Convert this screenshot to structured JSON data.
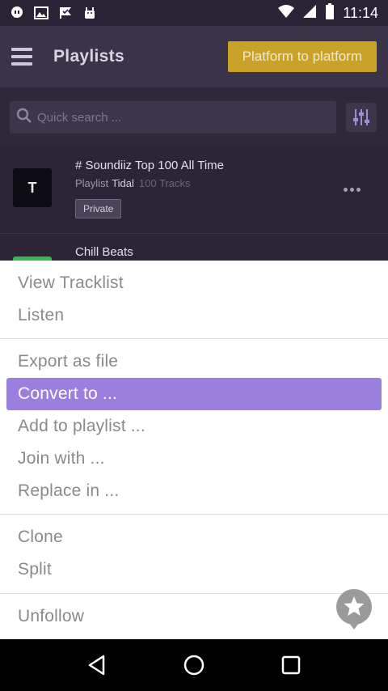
{
  "status_bar": {
    "time": "11:14",
    "icons": [
      "messenger-icon",
      "image-icon",
      "check-flag-icon",
      "android-icon"
    ],
    "right_icons": [
      "wifi-icon",
      "signal-icon",
      "battery-icon"
    ]
  },
  "app_bar": {
    "title": "Playlists",
    "platform_button": "Platform to platform",
    "accent_color": "#c9a227"
  },
  "search": {
    "placeholder": "Quick search ..."
  },
  "playlists": [
    {
      "thumb_letter": "T",
      "title": "# Soundiiz Top 100 All Time",
      "type": "Playlist",
      "service": "Tidal",
      "tracks": "100 Tracks",
      "badge": "Private"
    },
    {
      "title": "Chill Beats",
      "thumb_color": "#3bb84a"
    }
  ],
  "menu": {
    "groups": [
      [
        "View Tracklist",
        "Listen"
      ],
      [
        "Export as file",
        "Convert to ...",
        "Add to playlist ...",
        "Join with ...",
        "Replace in ..."
      ],
      [
        "Clone",
        "Split"
      ],
      [
        "Unfollow"
      ]
    ],
    "active_item": "Convert to ...",
    "highlight_color": "#9b7fdf"
  },
  "nav_bar": {
    "icons": [
      "back-icon",
      "home-icon",
      "recents-icon"
    ]
  }
}
